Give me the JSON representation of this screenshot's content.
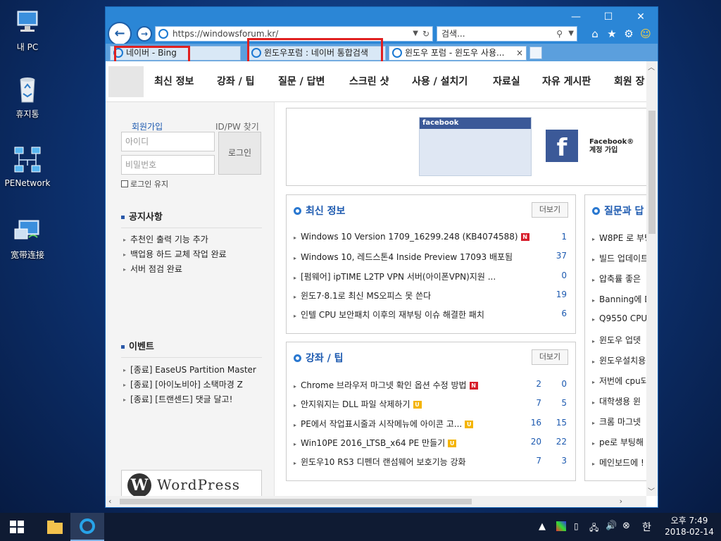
{
  "desktop": {
    "icons": [
      {
        "label": "내 PC",
        "icon": "computer-icon"
      },
      {
        "label": "휴지통",
        "icon": "recycle-bin-icon"
      },
      {
        "label": "PENetwork",
        "icon": "network-icon"
      },
      {
        "label": "宽带连接",
        "icon": "broadband-icon"
      }
    ]
  },
  "browser": {
    "address": "https://windowsforum.kr/",
    "search_placeholder": "검색...",
    "tabs": [
      {
        "label": "네이버 - Bing",
        "active": false
      },
      {
        "label": "윈도우포럼 : 네이버 통합검색",
        "active": false
      },
      {
        "label": "윈도우 포럼 - 윈도우 사용...",
        "active": true
      }
    ],
    "tab_close": "×"
  },
  "site": {
    "menu": [
      "최신 정보",
      "강좌 / 팁",
      "질문 / 답변",
      "스크린 샷",
      "사용 / 설치기",
      "자료실",
      "자유 게시판",
      "회원 장"
    ],
    "login": {
      "signup": "회원가입",
      "find": "ID/PW 찾기",
      "id_placeholder": "아이디",
      "pw_placeholder": "비밀번호",
      "button": "로그인",
      "keep": "로그인 유지"
    },
    "notice": {
      "title": "공지사항",
      "items": [
        "추천인 출력 기능 추가",
        "백업용 하드 교체 작업 완료",
        "서버 점검 완료"
      ]
    },
    "event": {
      "title": "이벤트",
      "items": [
        "[종료] EaseUS Partition Master",
        "[종료] [아이노비아] 소택마경 Z",
        "[종료] [트랜센드] 댓글 달고!"
      ]
    },
    "wordpress": "WordPress",
    "facebook": {
      "widget_label": "facebook",
      "cta": "Facebook®\n계정 가입"
    },
    "latest": {
      "title": "최신 정보",
      "more": "더보기",
      "rows": [
        {
          "text": "Windows 10 Version 1709_16299.248 (KB4074588)",
          "badge": "N",
          "c1": "",
          "c2": "1"
        },
        {
          "text": "Windows 10, 레드스톤4 Inside Preview 17093 배포됨",
          "badge": "",
          "c1": "",
          "c2": "37"
        },
        {
          "text": "[펌웨어] ipTIME L2TP VPN 서버(아이폰VPN)지원 ...",
          "badge": "",
          "c1": "",
          "c2": "0"
        },
        {
          "text": "윈도7·8.1로 최신 MS오피스 못 쓴다",
          "badge": "",
          "c1": "",
          "c2": "19"
        },
        {
          "text": "인텔 CPU 보안패치 이후의 재부팅 이슈 해결한 패치",
          "badge": "",
          "c1": "",
          "c2": "6"
        }
      ]
    },
    "tips": {
      "title": "강좌 / 팁",
      "more": "더보기",
      "rows": [
        {
          "text": "Chrome 브라우저 마그넷 확인 옵션 수정 방법",
          "badge": "N",
          "c1": "2",
          "c2": "0"
        },
        {
          "text": "안지워지는 DLL 파일 삭제하기",
          "badge": "U",
          "c1": "7",
          "c2": "5"
        },
        {
          "text": "PE에서 작업표시줄과 시작메뉴에 아이콘 고...",
          "badge": "U",
          "c1": "16",
          "c2": "15"
        },
        {
          "text": "Win10PE 2016_LTSB_x64 PE 만들기",
          "badge": "U",
          "c1": "20",
          "c2": "22"
        },
        {
          "text": "윈도우10 RS3 디펜더 랜섬웨어 보호기능 강화",
          "badge": "",
          "c1": "7",
          "c2": "3"
        }
      ]
    },
    "qa": {
      "title": "질문과 답",
      "rows": [
        "W8PE 로 부팅",
        "빌드 업데이트",
        "압축률 좋은",
        "Banning에 D",
        "Q9550 CPU",
        "윈도우 업뎃",
        "윈도우설치용",
        "저번에 cpu되",
        "대학생용 윈",
        "크롬 마그넷",
        "pe로 부팅해",
        "메인보드에 !"
      ]
    }
  },
  "taskbar": {
    "time": "오후 7:49",
    "date": "2018-02-14",
    "ime": "한"
  }
}
